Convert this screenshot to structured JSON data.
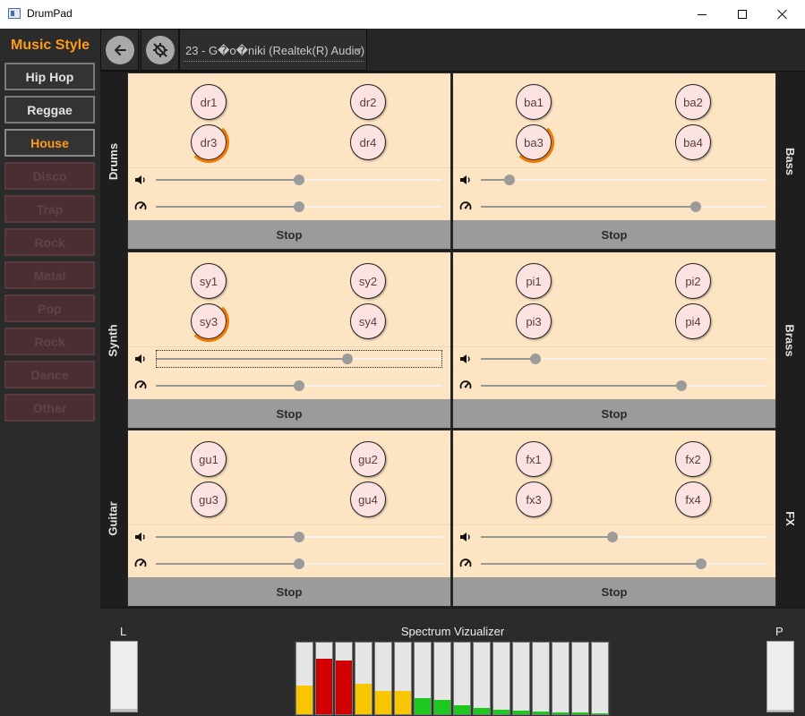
{
  "window": {
    "title": "DrumPad"
  },
  "sidebar": {
    "title": "Music Style",
    "styles": [
      {
        "label": "Hip Hop",
        "state": "enabled"
      },
      {
        "label": "Reggae",
        "state": "enabled"
      },
      {
        "label": "House",
        "state": "active"
      },
      {
        "label": "Disco",
        "state": "disabled"
      },
      {
        "label": "Trap",
        "state": "disabled"
      },
      {
        "label": "Rock",
        "state": "disabled"
      },
      {
        "label": "Metal",
        "state": "disabled"
      },
      {
        "label": "Pop",
        "state": "disabled"
      },
      {
        "label": "Rock",
        "state": "disabled"
      },
      {
        "label": "Dance",
        "state": "disabled"
      },
      {
        "label": "Other",
        "state": "disabled"
      }
    ]
  },
  "toolbar": {
    "back_icon": "arrow-left-icon",
    "mute_icon": "mic-off-icon",
    "device_label": "23 - G�o�niki (Realtek(R) Audio)"
  },
  "colors": {
    "accent": "#ff9b1a",
    "panel_bg": "#fde4c2",
    "pad_bg": "#fce3e2",
    "play_progress": "#f07a00",
    "level_green": "#1ec81e",
    "level_yellow": "#f7c600",
    "level_red": "#d10000"
  },
  "groups": {
    "drums": {
      "label": "Drums",
      "pads": [
        "dr1",
        "dr2",
        "dr3",
        "dr4"
      ],
      "playing": "dr3",
      "volume": 50,
      "speed": 50,
      "stop_label": "Stop"
    },
    "bass": {
      "label": "Bass",
      "pads": [
        "ba1",
        "ba2",
        "ba3",
        "ba4"
      ],
      "playing": "ba3",
      "volume": 10,
      "speed": 75,
      "stop_label": "Stop"
    },
    "synth": {
      "label": "Synth",
      "pads": [
        "sy1",
        "sy2",
        "sy3",
        "sy4"
      ],
      "playing": "sy3",
      "volume": 67,
      "speed": 50,
      "stop_label": "Stop"
    },
    "brass": {
      "label": "Brass",
      "pads": [
        "pi1",
        "pi2",
        "pi3",
        "pi4"
      ],
      "playing": "",
      "volume": 19,
      "speed": 70,
      "stop_label": "Stop"
    },
    "guitar": {
      "label": "Guitar",
      "pads": [
        "gu1",
        "gu2",
        "gu3",
        "gu4"
      ],
      "playing": "",
      "volume": 50,
      "speed": 50,
      "stop_label": "Stop"
    },
    "fx": {
      "label": "FX",
      "pads": [
        "fx1",
        "fx2",
        "fx3",
        "fx4"
      ],
      "playing": "",
      "volume": 46,
      "speed": 77,
      "stop_label": "Stop"
    }
  },
  "spectrum": {
    "title": "Spectrum Vizualizer",
    "left_label": "L",
    "right_label": "P",
    "left_level": 0.04,
    "right_level": 0.02,
    "bands": [
      {
        "level": 0.4,
        "color": "#f7c600"
      },
      {
        "level": 0.78,
        "color": "#d10000"
      },
      {
        "level": 0.75,
        "color": "#d10000"
      },
      {
        "level": 0.43,
        "color": "#f7c600"
      },
      {
        "level": 0.32,
        "color": "#f7c600"
      },
      {
        "level": 0.33,
        "color": "#f7c600"
      },
      {
        "level": 0.22,
        "color": "#1ec81e"
      },
      {
        "level": 0.2,
        "color": "#1ec81e"
      },
      {
        "level": 0.12,
        "color": "#1ec81e"
      },
      {
        "level": 0.09,
        "color": "#1ec81e"
      },
      {
        "level": 0.06,
        "color": "#1ec81e"
      },
      {
        "level": 0.05,
        "color": "#1ec81e"
      },
      {
        "level": 0.04,
        "color": "#1ec81e"
      },
      {
        "level": 0.03,
        "color": "#1ec81e"
      },
      {
        "level": 0.02,
        "color": "#1ec81e"
      },
      {
        "level": 0.01,
        "color": "#1ec81e"
      }
    ]
  }
}
